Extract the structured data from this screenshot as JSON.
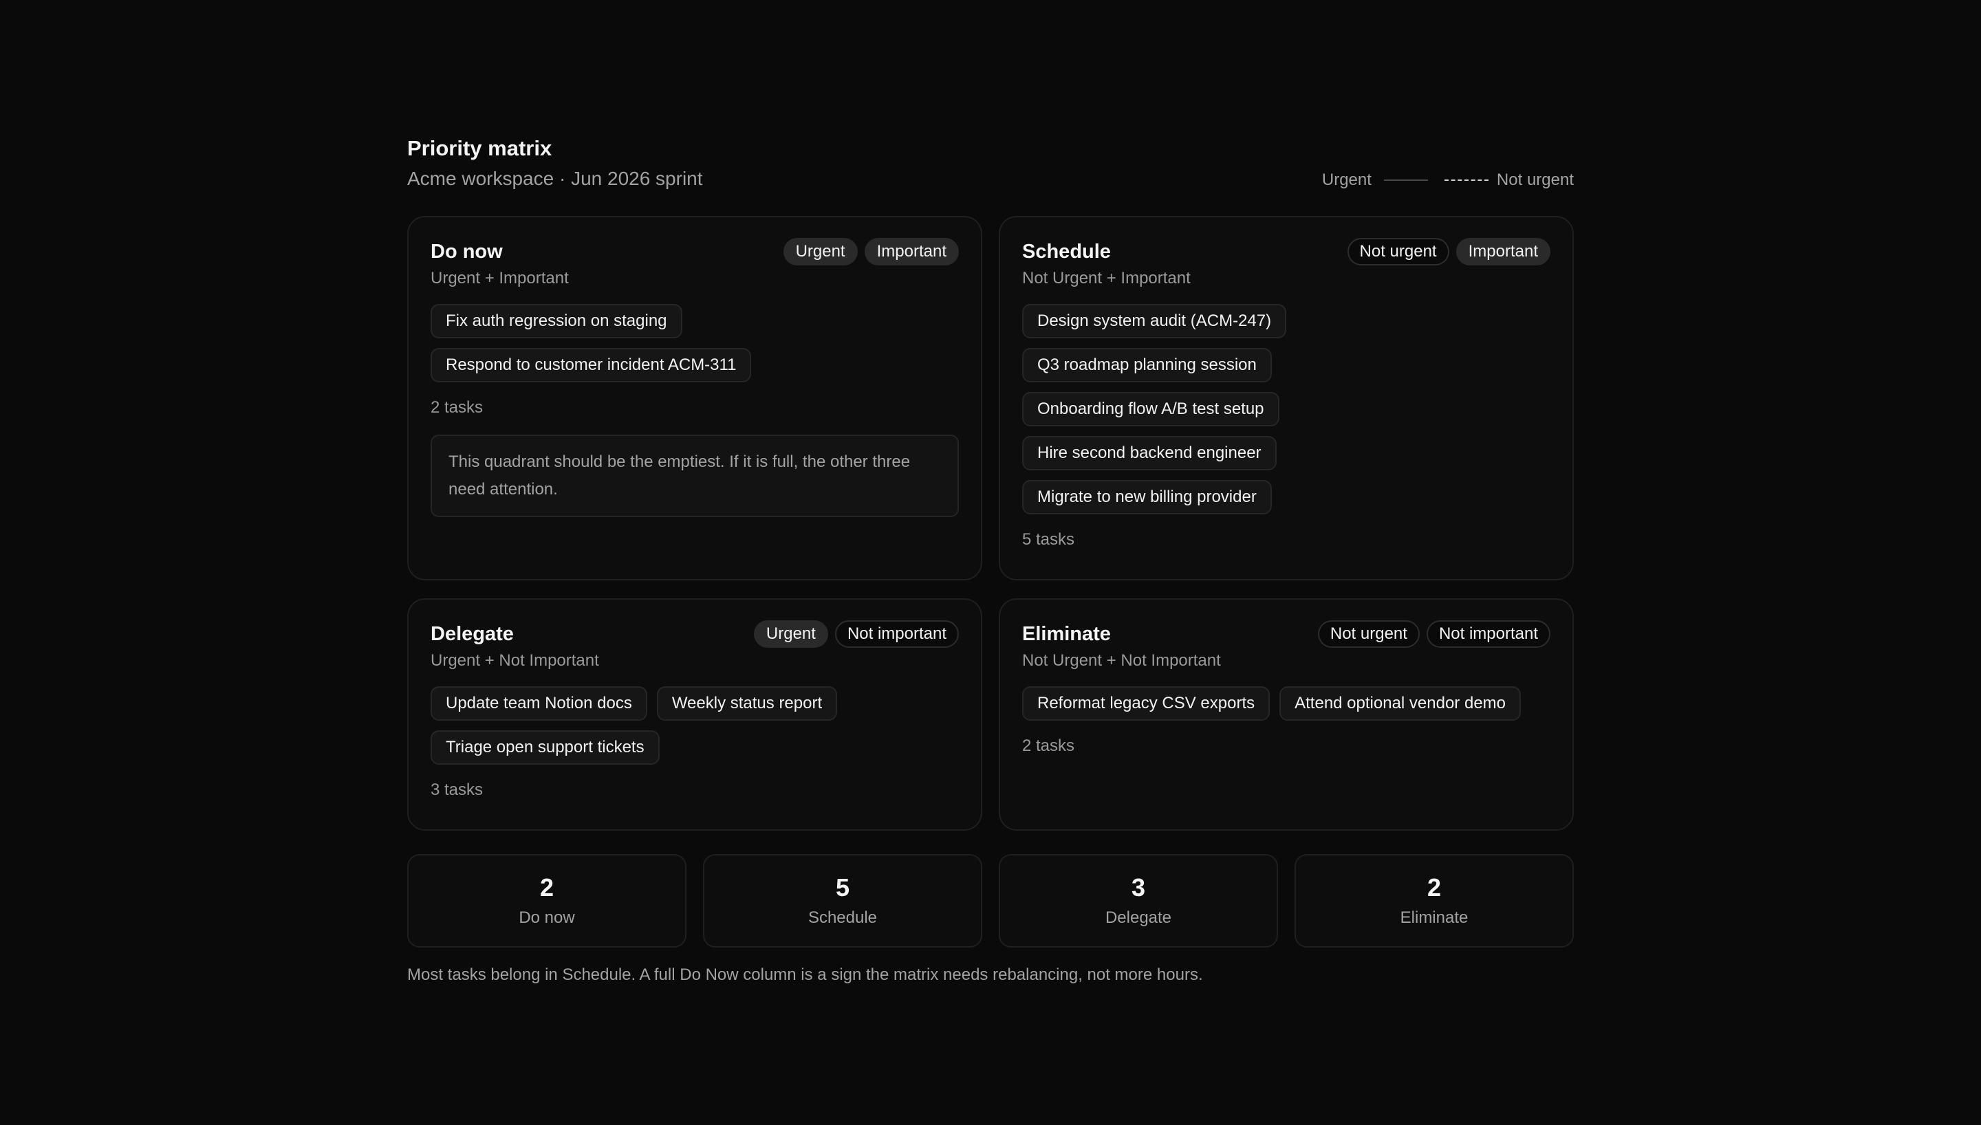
{
  "header": {
    "title": "Priority matrix",
    "subtitle": "Acme workspace · Jun 2026 sprint",
    "legend": {
      "urgent_label": "Urgent",
      "not_urgent_label": "Not urgent"
    }
  },
  "quadrants": [
    {
      "title": "Do now",
      "subtitle": "Urgent + Important",
      "badges": [
        "Urgent",
        "Important"
      ],
      "tasks": [
        "Fix auth regression on staging",
        "Respond to customer incident ACM-311"
      ],
      "count": "2 tasks",
      "note": "This quadrant should be the emptiest. If it is full, the other three need attention."
    },
    {
      "title": "Schedule",
      "subtitle": "Not Urgent + Important",
      "badges": [
        "Not urgent",
        "Important"
      ],
      "tasks": [
        "Design system audit (ACM-247)",
        "Q3 roadmap planning session",
        "Onboarding flow A/B test setup",
        "Hire second backend engineer",
        "Migrate to new billing provider"
      ],
      "count": "5 tasks"
    },
    {
      "title": "Delegate",
      "subtitle": "Urgent + Not Important",
      "badges": [
        "Urgent",
        "Not important"
      ],
      "tasks": [
        "Update team Notion docs",
        "Weekly status report",
        "Triage open support tickets"
      ],
      "count": "3 tasks"
    },
    {
      "title": "Eliminate",
      "subtitle": "Not Urgent + Not Important",
      "badges": [
        "Not urgent",
        "Not important"
      ],
      "tasks": [
        "Reformat legacy CSV exports",
        "Attend optional vendor demo"
      ],
      "count": "2 tasks"
    }
  ],
  "stats": [
    {
      "value": "2",
      "label": "Do now"
    },
    {
      "value": "5",
      "label": "Schedule"
    },
    {
      "value": "3",
      "label": "Delegate"
    },
    {
      "value": "2",
      "label": "Eliminate"
    }
  ],
  "footer": "Most tasks belong in Schedule. A full Do Now column is a sign the matrix needs rebalancing, not more hours."
}
